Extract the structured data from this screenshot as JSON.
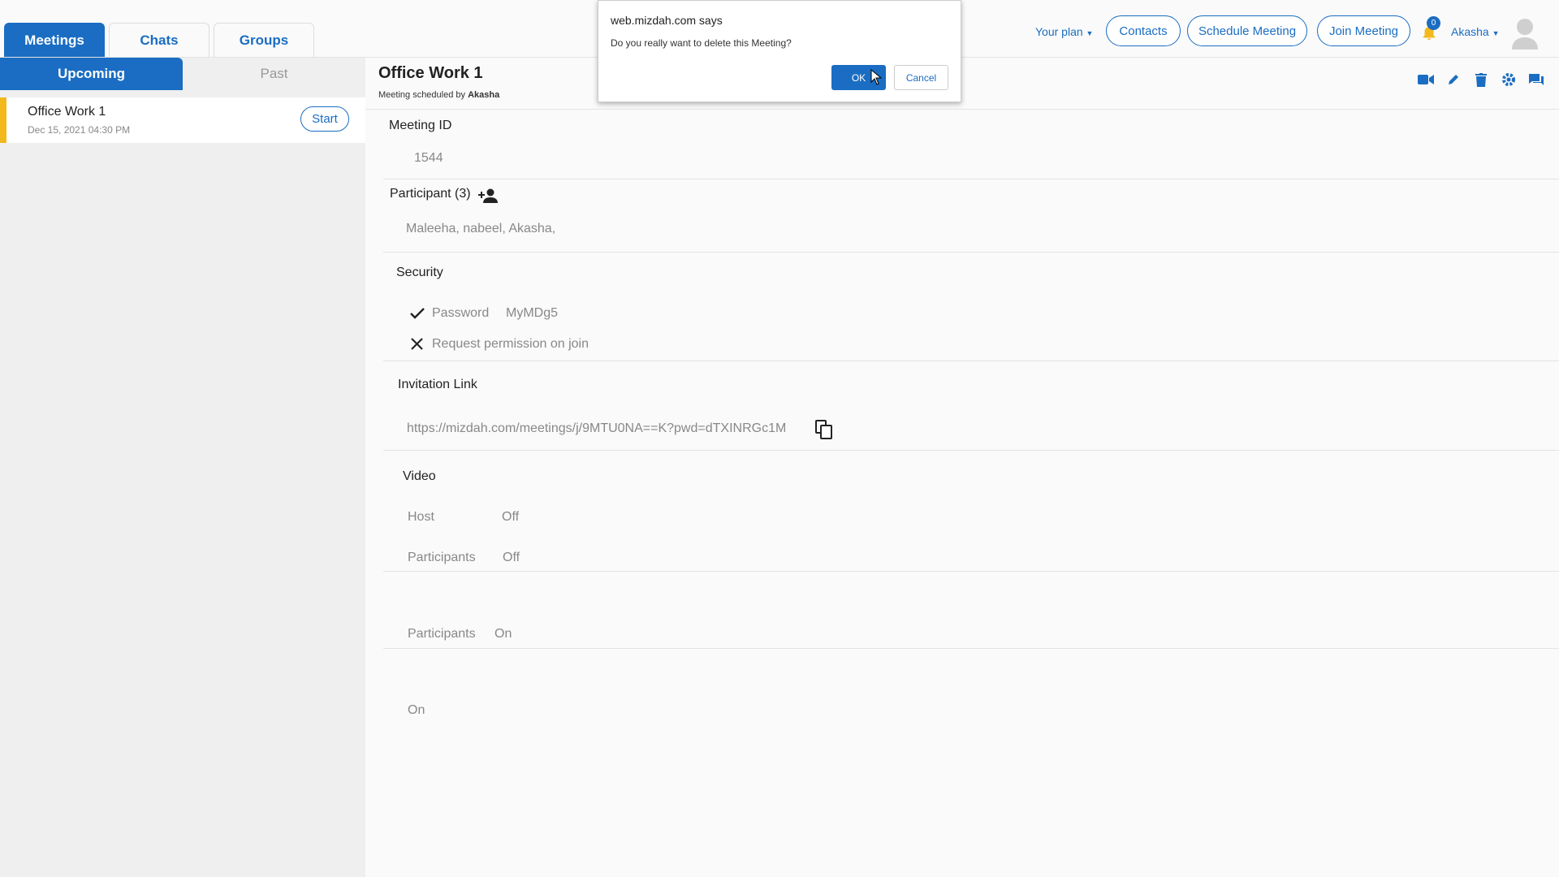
{
  "top_tabs": [
    "Meetings",
    "Chats",
    "Groups"
  ],
  "sub_tabs": [
    "Upcoming",
    "Past"
  ],
  "meeting_list": [
    {
      "title": "Office Work 1",
      "date": "Dec 15, 2021 04:30 PM",
      "action": "Start"
    }
  ],
  "header": {
    "plan": "Your plan",
    "contacts": "Contacts",
    "schedule": "Schedule Meeting",
    "join": "Join Meeting",
    "notifications": "0",
    "user": "Akasha"
  },
  "meeting": {
    "title": "Office Work 1",
    "scheduled_prefix": "Meeting scheduled by",
    "scheduled_by": "Akasha",
    "meeting_id_label": "Meeting ID",
    "meeting_id": "1544",
    "participants_label": "Participant (3)",
    "participants": "Maleeha, nabeel, Akasha,",
    "security_label": "Security",
    "password_label": "Password",
    "password": "MyMDg5",
    "request_permission": "Request permission on join",
    "invitation_label": "Invitation Link",
    "invitation_link": "https://mizdah.com/meetings/j/9MTU0NA==K?pwd=dTXINRGc1M",
    "video_label": "Video",
    "host_label": "Host",
    "host_video": "Off",
    "participants_video_label": "Participants",
    "participants_video": "Off",
    "audio_participants_label": "Participants",
    "audio_participants": "On",
    "extra_value": "On"
  },
  "dialog": {
    "title": "web.mizdah.com says",
    "message": "Do you really want to delete this Meeting?",
    "ok": "OK",
    "cancel": "Cancel"
  },
  "colors": {
    "accent": "#1a6dc2",
    "highlight": "#f3b81c",
    "notification": "#f3b81c"
  }
}
